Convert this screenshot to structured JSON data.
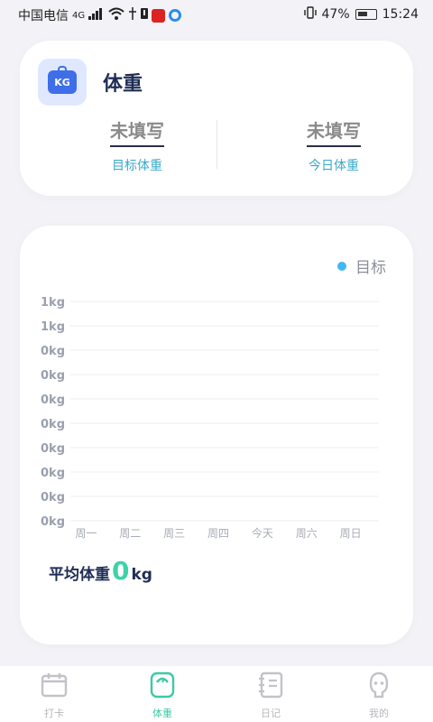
{
  "status_bar": {
    "carrier": "中国电信",
    "network": "4G",
    "battery": "47%",
    "time": "15:24"
  },
  "weight_card": {
    "title": "体重",
    "icon_text": "KG",
    "target": {
      "value": "未填写",
      "label": "目标体重"
    },
    "today": {
      "value": "未填写",
      "label": "今日体重"
    }
  },
  "chart_card": {
    "legend": "目标",
    "avg_label": "平均体重",
    "avg_value": "0",
    "avg_unit": "kg"
  },
  "chart_data": {
    "type": "line",
    "categories": [
      "周一",
      "周二",
      "周三",
      "周四",
      "今天",
      "周六",
      "周日"
    ],
    "y_tick_labels": [
      "1kg",
      "1kg",
      "0kg",
      "0kg",
      "0kg",
      "0kg",
      "0kg",
      "0kg",
      "0kg",
      "0kg"
    ],
    "series": [
      {
        "name": "目标",
        "values": []
      }
    ],
    "grid": true,
    "legend_position": "top-right",
    "colors": {
      "series": "#42b8ef",
      "grid": "#eeeeef",
      "tick": "#9aa0ad",
      "xtick": "#a8acb6"
    }
  },
  "bottom_nav": {
    "items": [
      {
        "label": "打卡",
        "icon": "calendar-icon",
        "active": false
      },
      {
        "label": "体重",
        "icon": "scale-icon",
        "active": true
      },
      {
        "label": "日记",
        "icon": "notebook-icon",
        "active": false
      },
      {
        "label": "我的",
        "icon": "profile-icon",
        "active": false
      }
    ],
    "active_color": "#3ec9a6",
    "inactive_color": "#c2c2c8"
  }
}
